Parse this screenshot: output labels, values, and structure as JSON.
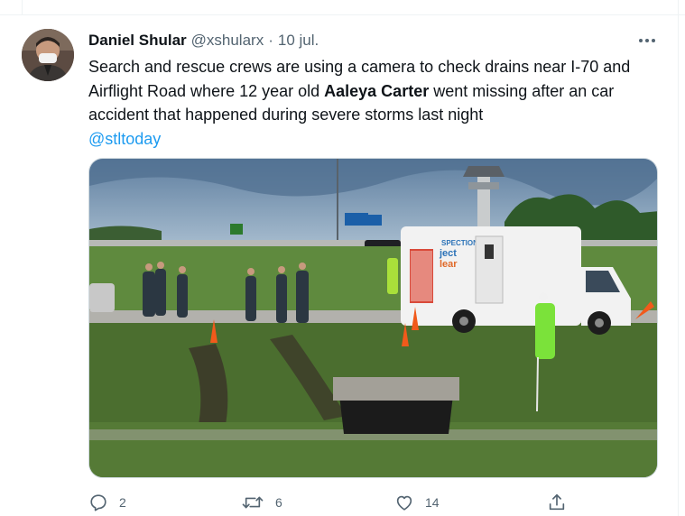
{
  "tweet": {
    "author": {
      "name": "Daniel Shular",
      "handle": "@xshularx"
    },
    "separator": "·",
    "date": "10 jul.",
    "text": {
      "part1": "Search and rescue crews are using a camera to check drains near I-70 and Airflight Road where 12 year old ",
      "bold_name": "Aaleya Carter",
      "part2": " went missing after an car accident that happened during severe storms last night",
      "mention": "@stltoday"
    },
    "media": {
      "truck_sign_line1": "SPECTION",
      "truck_sign_line2": "ject",
      "truck_sign_line3": "lear"
    },
    "actions": {
      "reply": {
        "icon": "reply-icon",
        "count": "2"
      },
      "retweet": {
        "icon": "retweet-icon",
        "count": "6"
      },
      "like": {
        "icon": "heart-icon",
        "count": "14"
      },
      "share": {
        "icon": "share-icon"
      }
    }
  },
  "colors": {
    "text": "#0f1419",
    "secondary": "#536471",
    "accent": "#1d9bf0",
    "border": "#cfd9de"
  }
}
